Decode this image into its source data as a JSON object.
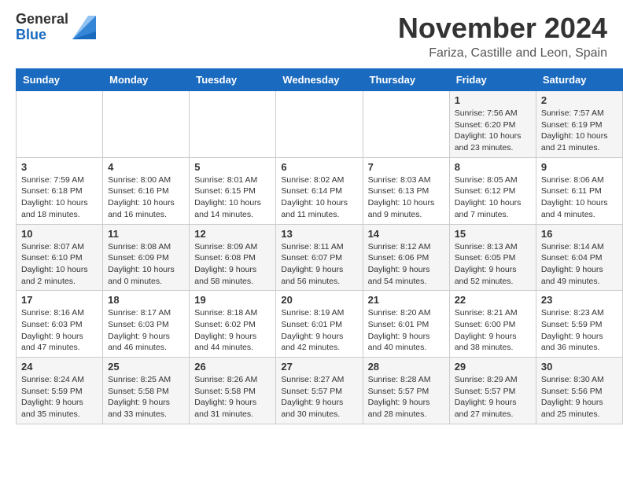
{
  "header": {
    "logo": {
      "general": "General",
      "blue": "Blue"
    },
    "title": "November 2024",
    "location": "Fariza, Castille and Leon, Spain"
  },
  "calendar": {
    "headers": [
      "Sunday",
      "Monday",
      "Tuesday",
      "Wednesday",
      "Thursday",
      "Friday",
      "Saturday"
    ],
    "weeks": [
      [
        {
          "day": "",
          "info": ""
        },
        {
          "day": "",
          "info": ""
        },
        {
          "day": "",
          "info": ""
        },
        {
          "day": "",
          "info": ""
        },
        {
          "day": "",
          "info": ""
        },
        {
          "day": "1",
          "info": "Sunrise: 7:56 AM\nSunset: 6:20 PM\nDaylight: 10 hours and 23 minutes."
        },
        {
          "day": "2",
          "info": "Sunrise: 7:57 AM\nSunset: 6:19 PM\nDaylight: 10 hours and 21 minutes."
        }
      ],
      [
        {
          "day": "3",
          "info": "Sunrise: 7:59 AM\nSunset: 6:18 PM\nDaylight: 10 hours and 18 minutes."
        },
        {
          "day": "4",
          "info": "Sunrise: 8:00 AM\nSunset: 6:16 PM\nDaylight: 10 hours and 16 minutes."
        },
        {
          "day": "5",
          "info": "Sunrise: 8:01 AM\nSunset: 6:15 PM\nDaylight: 10 hours and 14 minutes."
        },
        {
          "day": "6",
          "info": "Sunrise: 8:02 AM\nSunset: 6:14 PM\nDaylight: 10 hours and 11 minutes."
        },
        {
          "day": "7",
          "info": "Sunrise: 8:03 AM\nSunset: 6:13 PM\nDaylight: 10 hours and 9 minutes."
        },
        {
          "day": "8",
          "info": "Sunrise: 8:05 AM\nSunset: 6:12 PM\nDaylight: 10 hours and 7 minutes."
        },
        {
          "day": "9",
          "info": "Sunrise: 8:06 AM\nSunset: 6:11 PM\nDaylight: 10 hours and 4 minutes."
        }
      ],
      [
        {
          "day": "10",
          "info": "Sunrise: 8:07 AM\nSunset: 6:10 PM\nDaylight: 10 hours and 2 minutes."
        },
        {
          "day": "11",
          "info": "Sunrise: 8:08 AM\nSunset: 6:09 PM\nDaylight: 10 hours and 0 minutes."
        },
        {
          "day": "12",
          "info": "Sunrise: 8:09 AM\nSunset: 6:08 PM\nDaylight: 9 hours and 58 minutes."
        },
        {
          "day": "13",
          "info": "Sunrise: 8:11 AM\nSunset: 6:07 PM\nDaylight: 9 hours and 56 minutes."
        },
        {
          "day": "14",
          "info": "Sunrise: 8:12 AM\nSunset: 6:06 PM\nDaylight: 9 hours and 54 minutes."
        },
        {
          "day": "15",
          "info": "Sunrise: 8:13 AM\nSunset: 6:05 PM\nDaylight: 9 hours and 52 minutes."
        },
        {
          "day": "16",
          "info": "Sunrise: 8:14 AM\nSunset: 6:04 PM\nDaylight: 9 hours and 49 minutes."
        }
      ],
      [
        {
          "day": "17",
          "info": "Sunrise: 8:16 AM\nSunset: 6:03 PM\nDaylight: 9 hours and 47 minutes."
        },
        {
          "day": "18",
          "info": "Sunrise: 8:17 AM\nSunset: 6:03 PM\nDaylight: 9 hours and 46 minutes."
        },
        {
          "day": "19",
          "info": "Sunrise: 8:18 AM\nSunset: 6:02 PM\nDaylight: 9 hours and 44 minutes."
        },
        {
          "day": "20",
          "info": "Sunrise: 8:19 AM\nSunset: 6:01 PM\nDaylight: 9 hours and 42 minutes."
        },
        {
          "day": "21",
          "info": "Sunrise: 8:20 AM\nSunset: 6:01 PM\nDaylight: 9 hours and 40 minutes."
        },
        {
          "day": "22",
          "info": "Sunrise: 8:21 AM\nSunset: 6:00 PM\nDaylight: 9 hours and 38 minutes."
        },
        {
          "day": "23",
          "info": "Sunrise: 8:23 AM\nSunset: 5:59 PM\nDaylight: 9 hours and 36 minutes."
        }
      ],
      [
        {
          "day": "24",
          "info": "Sunrise: 8:24 AM\nSunset: 5:59 PM\nDaylight: 9 hours and 35 minutes."
        },
        {
          "day": "25",
          "info": "Sunrise: 8:25 AM\nSunset: 5:58 PM\nDaylight: 9 hours and 33 minutes."
        },
        {
          "day": "26",
          "info": "Sunrise: 8:26 AM\nSunset: 5:58 PM\nDaylight: 9 hours and 31 minutes."
        },
        {
          "day": "27",
          "info": "Sunrise: 8:27 AM\nSunset: 5:57 PM\nDaylight: 9 hours and 30 minutes."
        },
        {
          "day": "28",
          "info": "Sunrise: 8:28 AM\nSunset: 5:57 PM\nDaylight: 9 hours and 28 minutes."
        },
        {
          "day": "29",
          "info": "Sunrise: 8:29 AM\nSunset: 5:57 PM\nDaylight: 9 hours and 27 minutes."
        },
        {
          "day": "30",
          "info": "Sunrise: 8:30 AM\nSunset: 5:56 PM\nDaylight: 9 hours and 25 minutes."
        }
      ]
    ]
  }
}
